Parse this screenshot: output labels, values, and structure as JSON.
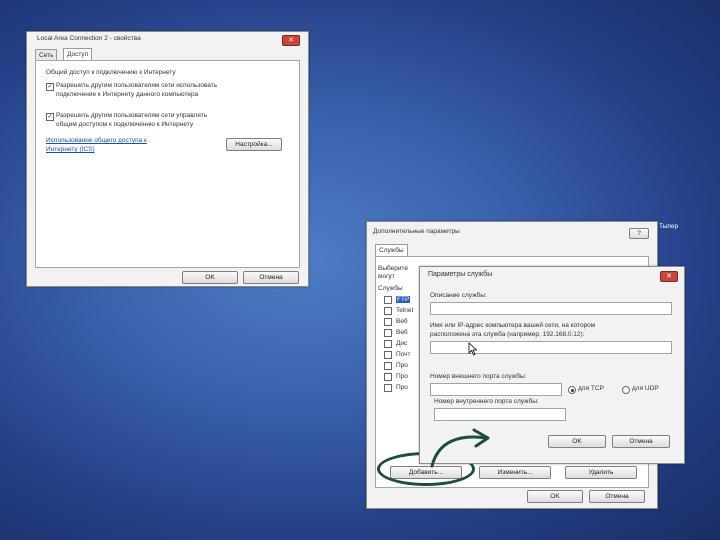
{
  "win1": {
    "title": "Local Area Connection 2 - свойства",
    "close_label": "✕",
    "tabs": [
      "Сеть",
      "Доступ"
    ],
    "group_title": "Общий доступ к подключению к Интернету",
    "check1_line1": "Разрешить другим пользователям сети использовать",
    "check1_line2": "подключение к Интернету данного компьютера",
    "check2_line1": "Разрешить другим пользователям сети управлять",
    "check2_line2": "общим доступом к подключению к Интернету",
    "link_line1": "Использование общего доступа к",
    "link_line2": "Интернету (ICS)",
    "settings_label": "Настройка...",
    "ok_label": "OK",
    "cancel_label": "Отмена"
  },
  "win2": {
    "title": "Дополнительные параметры",
    "help_label": "?",
    "edge_text": "Тыпер",
    "tab": "Службы",
    "intro_label": "Выберите",
    "intro_line2": "могут",
    "services_label": "Службы",
    "services": [
      "FTP",
      "Telnet",
      "Веб",
      "Веб",
      "Дис",
      "Почт",
      "Про",
      "Про",
      "Про"
    ],
    "add_label": "Добавить...",
    "edit_label": "Изменить...",
    "delete_label": "Удалить",
    "ok_label": "OK",
    "cancel_label": "Отмена"
  },
  "win3": {
    "title": "Параметры службы",
    "close_label": "✕",
    "desc_label": "Описание службы:",
    "host_label_line1": "Имя или IP-адрес компьютера вашей сети, на котором",
    "host_label_line2": "расположена эта служба (например, 192.168.0.12):",
    "ext_port_label": "Номер внешнего порта службы:",
    "tcp_label": "для TCP",
    "udp_label": "для UDP",
    "int_port_label": "Номер внутреннего порта службы:",
    "ok_label": "OK",
    "cancel_label": "Отмена"
  },
  "colors": {
    "accent_circle": "#1c4f36",
    "arrow": "#1c4f36",
    "close_red": "#c9473a"
  }
}
